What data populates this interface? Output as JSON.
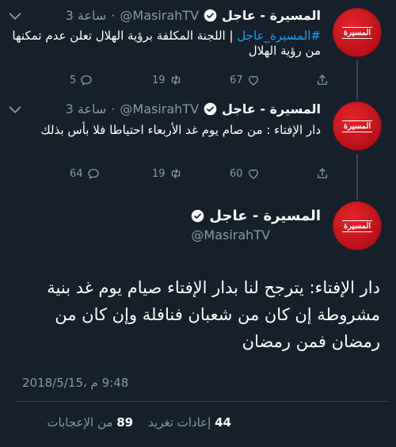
{
  "tweets": [
    {
      "name": "المسيرة - عاجل",
      "handle": "@MasirahTV",
      "dot": "·",
      "time": "3 ساعة",
      "hashtag": "#المسيرة_عاجل",
      "text": " | اللجنة المكلفة برؤية الهلال تعلن عدم تمكنها من رؤية الهلال",
      "replies": "5",
      "retweets": "19",
      "likes": "67",
      "avatar_logo": "المسيرة"
    },
    {
      "name": "المسيرة - عاجل",
      "handle": "@MasirahTV",
      "dot": "·",
      "time": "3 ساعة",
      "text": "دار الإفتاء : من صام يوم غد الأربعاء احتياطا فلا بأس بذلك",
      "replies": "64",
      "retweets": "19",
      "likes": "60",
      "avatar_logo": "المسيرة"
    }
  ],
  "main_tweet": {
    "name": "المسيرة - عاجل",
    "handle": "@MasirahTV",
    "text": "دار الإفتاء: يترجح لنا بدار الإفتاء صيام يوم غد بنية مشروطة إن كان من شعبان فنافلة وإن كان من رمضان فمن رمضان",
    "datetime": "9:48 م ،2018/5/15",
    "likes_count": "89",
    "likes_label": "من الإعجابات",
    "retweets_count": "44",
    "retweets_label": "إعادات تغريد",
    "avatar_logo": "المسيرة"
  },
  "colors": {
    "background": "#15202b",
    "text": "#ffffff",
    "muted": "#8899a6",
    "link": "#1da1f2",
    "avatar": "#d9202a"
  }
}
